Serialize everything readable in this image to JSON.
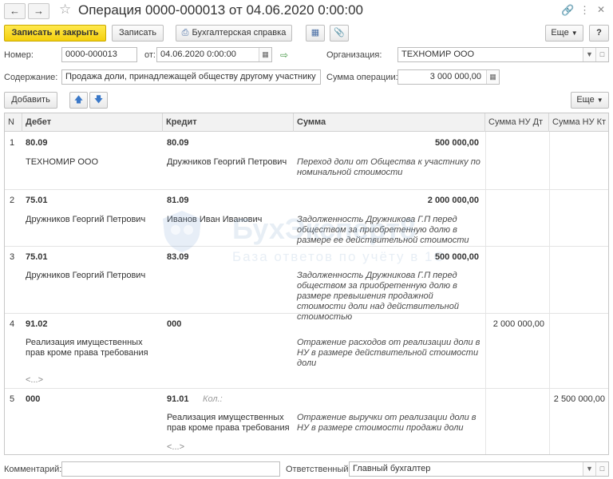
{
  "window": {
    "title": "Операция 0000-000013 от 04.06.2020 0:00:00"
  },
  "toolbar": {
    "save_close": "Записать и закрыть",
    "save": "Записать",
    "report": "Бухгалтерская справка",
    "more": "Еще",
    "help": "?"
  },
  "form": {
    "number_label": "Номер:",
    "number_value": "0000-000013",
    "date_label": "от:",
    "date_value": "04.06.2020  0:00:00",
    "org_label": "Организация:",
    "org_value": "ТЕХНОМИР ООО",
    "content_label": "Содержание:",
    "content_value": "Продажа доли, принадлежащей обществу другому участнику",
    "sum_label": "Сумма операции:",
    "sum_value": "3 000 000,00"
  },
  "table_toolbar": {
    "add": "Добавить",
    "more": "Еще"
  },
  "table": {
    "columns": [
      "N",
      "Дебет",
      "Кредит",
      "Сумма",
      "Сумма НУ Дт",
      "Сумма НУ Кт"
    ],
    "rows": [
      {
        "n": "1",
        "debit": "80.09",
        "credit": "80.09",
        "sum": "500 000,00",
        "debit_sub": "ТЕХНОМИР ООО",
        "credit_sub": "Дружников Георгий Петрович",
        "content": "Переход доли от Общества к участнику по номинальной стоимости",
        "nu_dt": "",
        "nu_kt": ""
      },
      {
        "n": "2",
        "debit": "75.01",
        "credit": "81.09",
        "sum": "2 000 000,00",
        "debit_sub": "Дружников Георгий Петрович",
        "credit_sub": "Иванов Иван Иванович",
        "content": "Задолженность Дружникова Г.П перед обществом за приобретенную долю в размере ее действительной стоимости",
        "nu_dt": "",
        "nu_kt": ""
      },
      {
        "n": "3",
        "debit": "75.01",
        "credit": "83.09",
        "sum": "500 000,00",
        "debit_sub": "Дружников Георгий Петрович",
        "credit_sub": "",
        "content": "Задолженность Дружникова Г.П перед обществом за приобретенную долю в размере превышения продажной стоимости доли над действительной стоимостью",
        "nu_dt": "",
        "nu_kt": ""
      },
      {
        "n": "4",
        "debit": "91.02",
        "credit": "000",
        "sum": "",
        "debit_sub": "Реализация имущественных прав кроме права требования",
        "credit_sub": "",
        "content": "Отражение расходов от реализации доли в НУ в размере действительной стоимости доли",
        "nu_dt": "2 000 000,00",
        "nu_kt": "",
        "ellipsis": "<...>"
      },
      {
        "n": "5",
        "debit": "000",
        "credit": "91.01",
        "kol": "Кол.:",
        "sum": "",
        "debit_sub": "",
        "credit_sub": "Реализация имущественных прав кроме права требования",
        "content": "Отражение выручки от реализации доли в НУ в размере стоимости продажи доли",
        "nu_dt": "",
        "nu_kt": "2 500 000,00",
        "ellipsis": "<...>"
      }
    ]
  },
  "footer": {
    "comment_label": "Комментарий:",
    "comment_value": "",
    "resp_label": "Ответственный:",
    "resp_value": "Главный бухгалтер"
  },
  "watermark": {
    "brand": "БухЭксперт8",
    "tagline": "База ответов по учёту в 1С"
  },
  "colors": {
    "primary_button": "#f4cf0d",
    "accent": "#4a6fa5"
  }
}
